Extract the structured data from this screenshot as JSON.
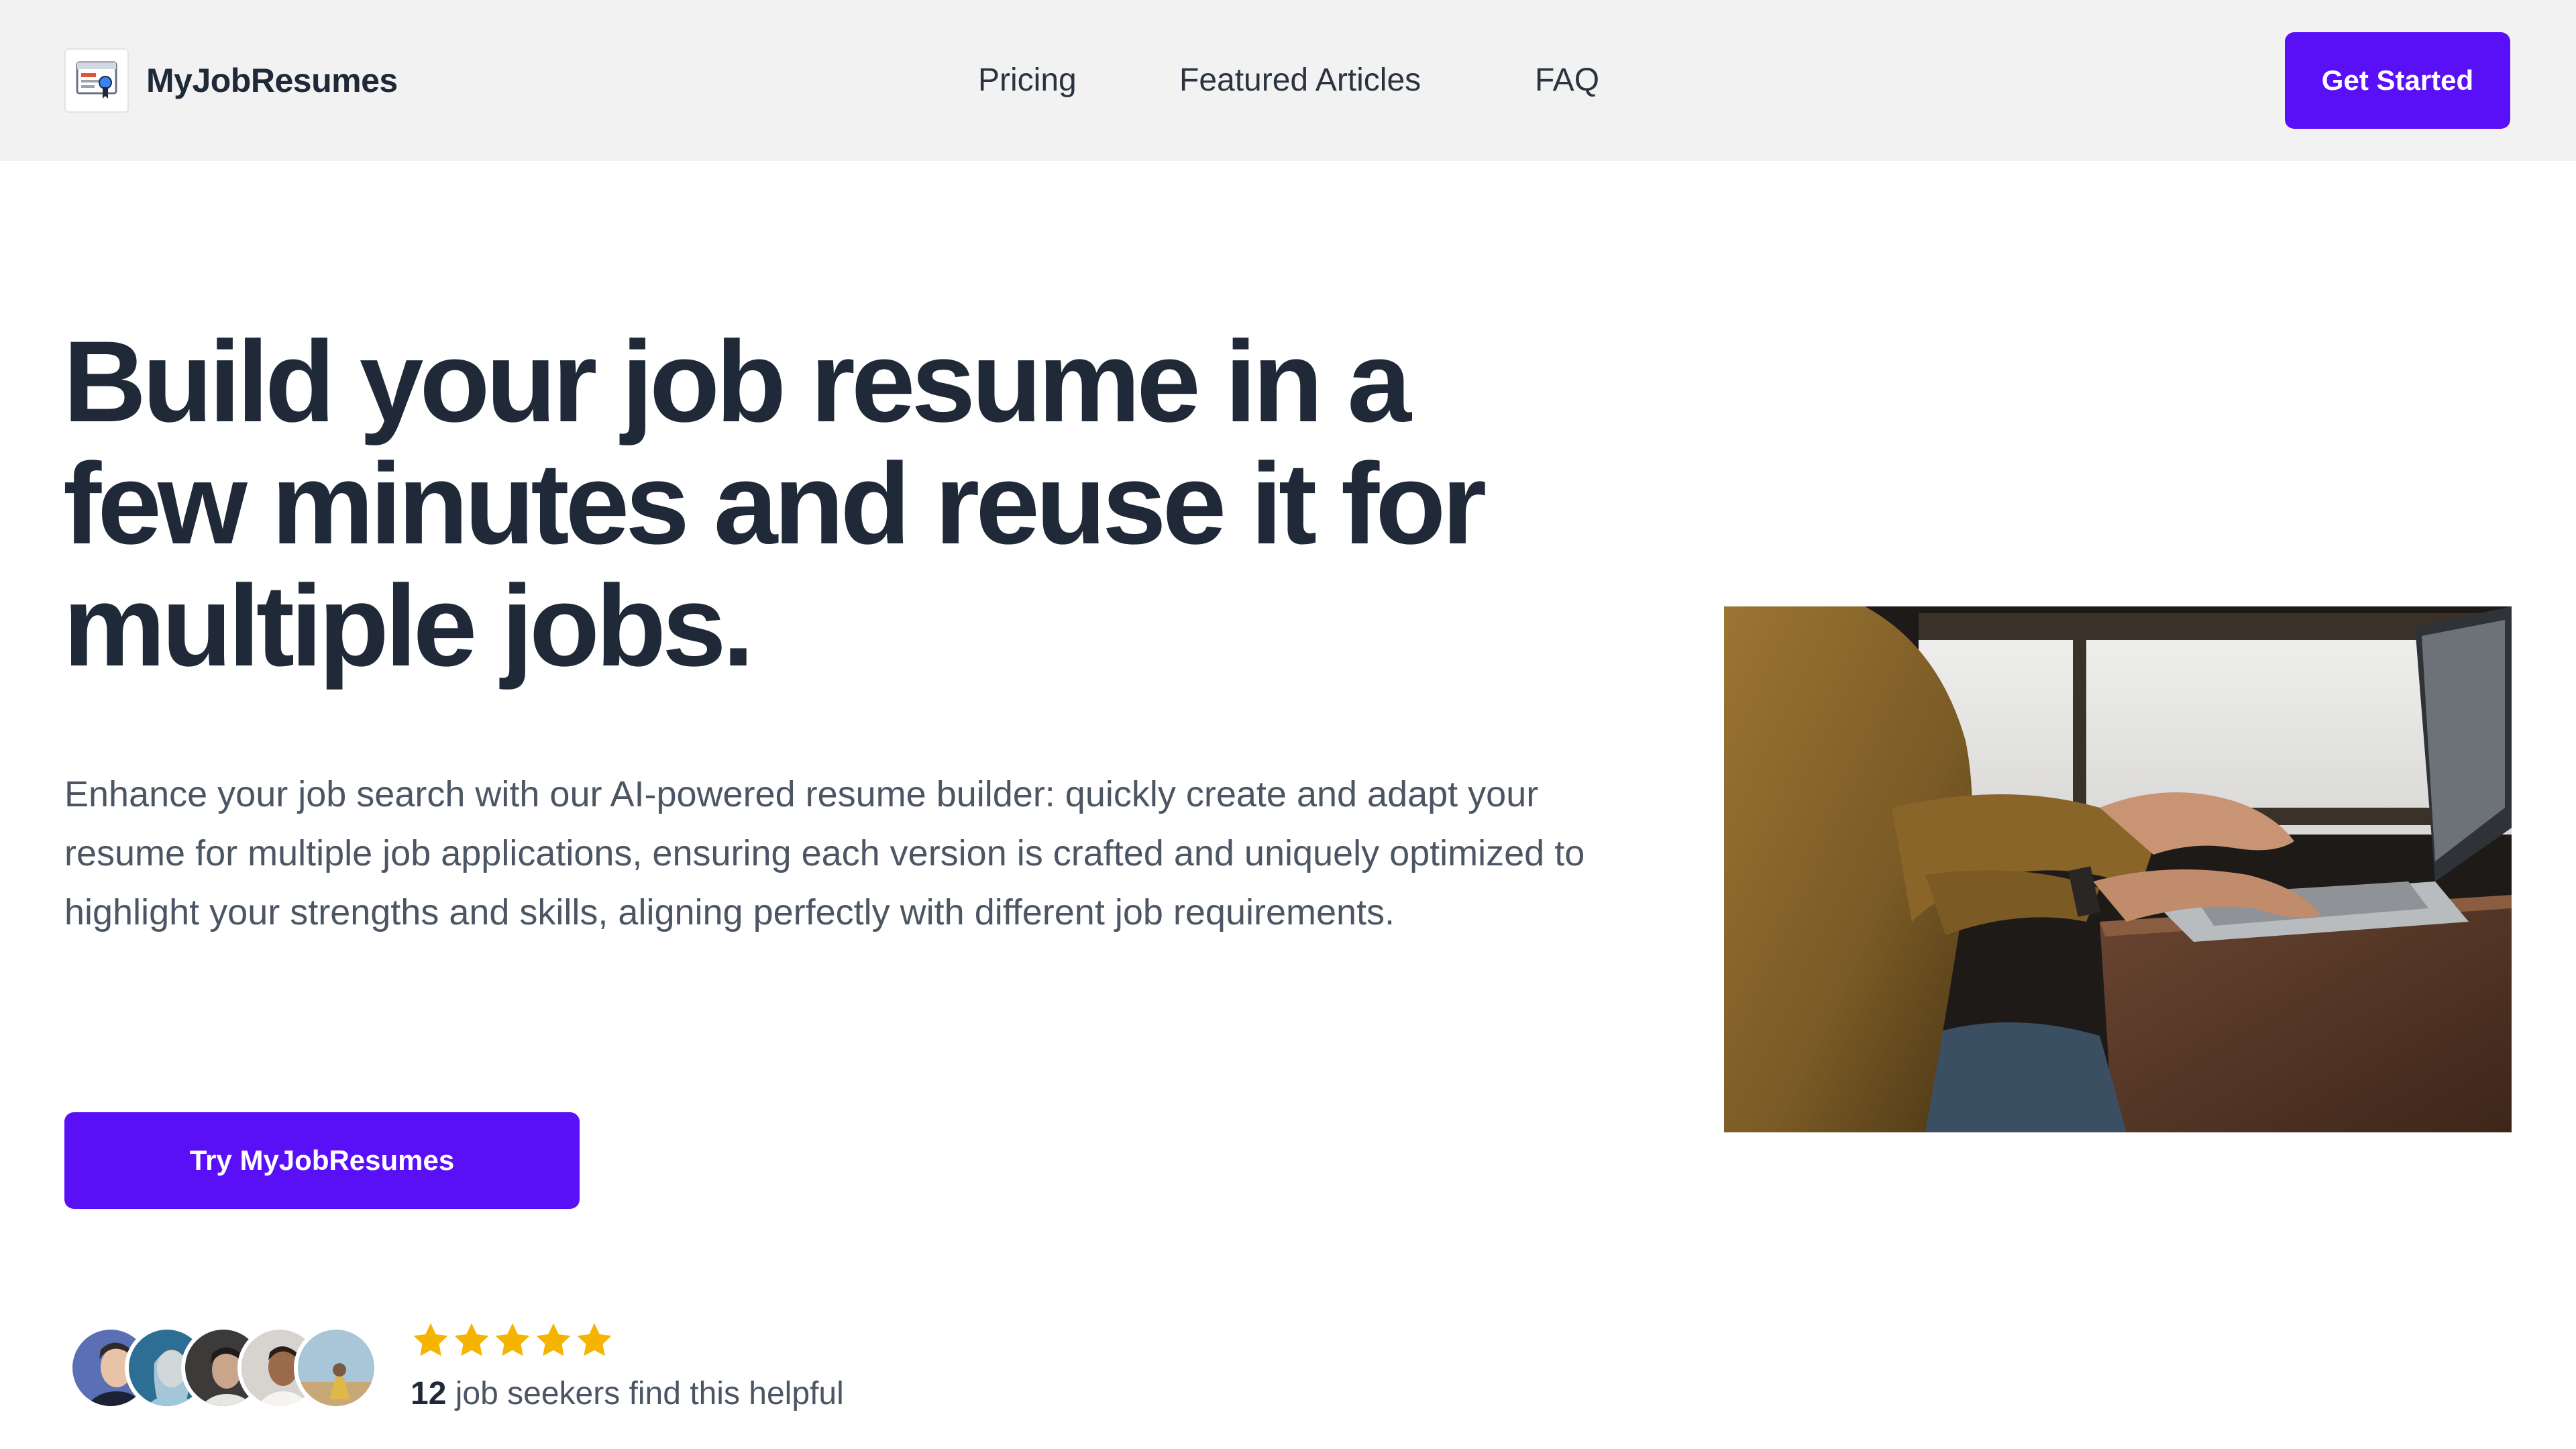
{
  "header": {
    "brand_name": "MyJobResumes",
    "nav": {
      "pricing": "Pricing",
      "featured_articles": "Featured Articles",
      "faq": "FAQ"
    },
    "cta_label": "Get Started"
  },
  "hero": {
    "title": "Build your job resume in a few minutes and reuse it for multiple jobs.",
    "description": "Enhance your job search with our AI-powered resume builder: quickly create and adapt your resume for multiple job applications, ensuring each version is crafted and uniquely optimized to highlight your strengths and skills, aligning perfectly with different job requirements.",
    "cta_label": "Try MyJobResumes"
  },
  "social_proof": {
    "rating": 5,
    "count": "12",
    "text": " job seekers find this helpful"
  },
  "colors": {
    "accent": "#5a10f7",
    "header_bg": "#f2f2f2",
    "heading": "#1f2937",
    "body_text": "#4b5563",
    "star": "#f4b400"
  },
  "icons": {
    "logo": "resume-certificate-icon",
    "rating": "star-icon"
  }
}
